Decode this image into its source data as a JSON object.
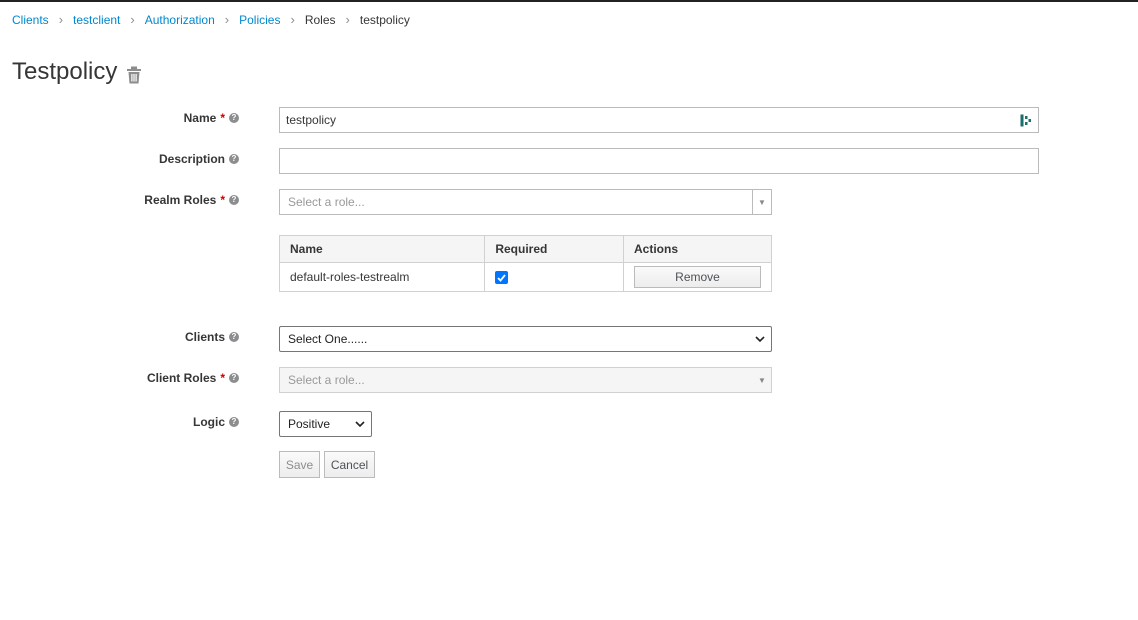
{
  "breadcrumb": {
    "clients": "Clients",
    "testclient": "testclient",
    "authorization": "Authorization",
    "policies": "Policies",
    "roles": "Roles",
    "current": "testpolicy",
    "separator": "›"
  },
  "page_title": "Testpolicy",
  "form": {
    "name_label": "Name",
    "name_value": "testpolicy",
    "description_label": "Description",
    "description_value": "",
    "realm_roles_label": "Realm Roles",
    "realm_roles_placeholder": "Select a role...",
    "required_mark": "*",
    "help_mark": "?",
    "table": {
      "headers": [
        "Name",
        "Required",
        "Actions"
      ],
      "rows": [
        {
          "name": "default-roles-testrealm",
          "required": true,
          "action": "Remove"
        }
      ]
    },
    "clients_label": "Clients",
    "clients_value": "Select One......",
    "client_roles_label": "Client Roles",
    "client_roles_placeholder": "Select a role...",
    "logic_label": "Logic",
    "logic_value": "Positive",
    "save_label": "Save",
    "cancel_label": "Cancel"
  },
  "icons": {
    "trash": "trash-icon",
    "help": "question-circle-icon",
    "password_manager": "password-manager-icon",
    "checkbox": "check-icon"
  },
  "colors": {
    "link": "#0088ce",
    "required": "#cc0000",
    "checkbox": "#0075ff",
    "pm_icon": "#1a6e6e"
  }
}
